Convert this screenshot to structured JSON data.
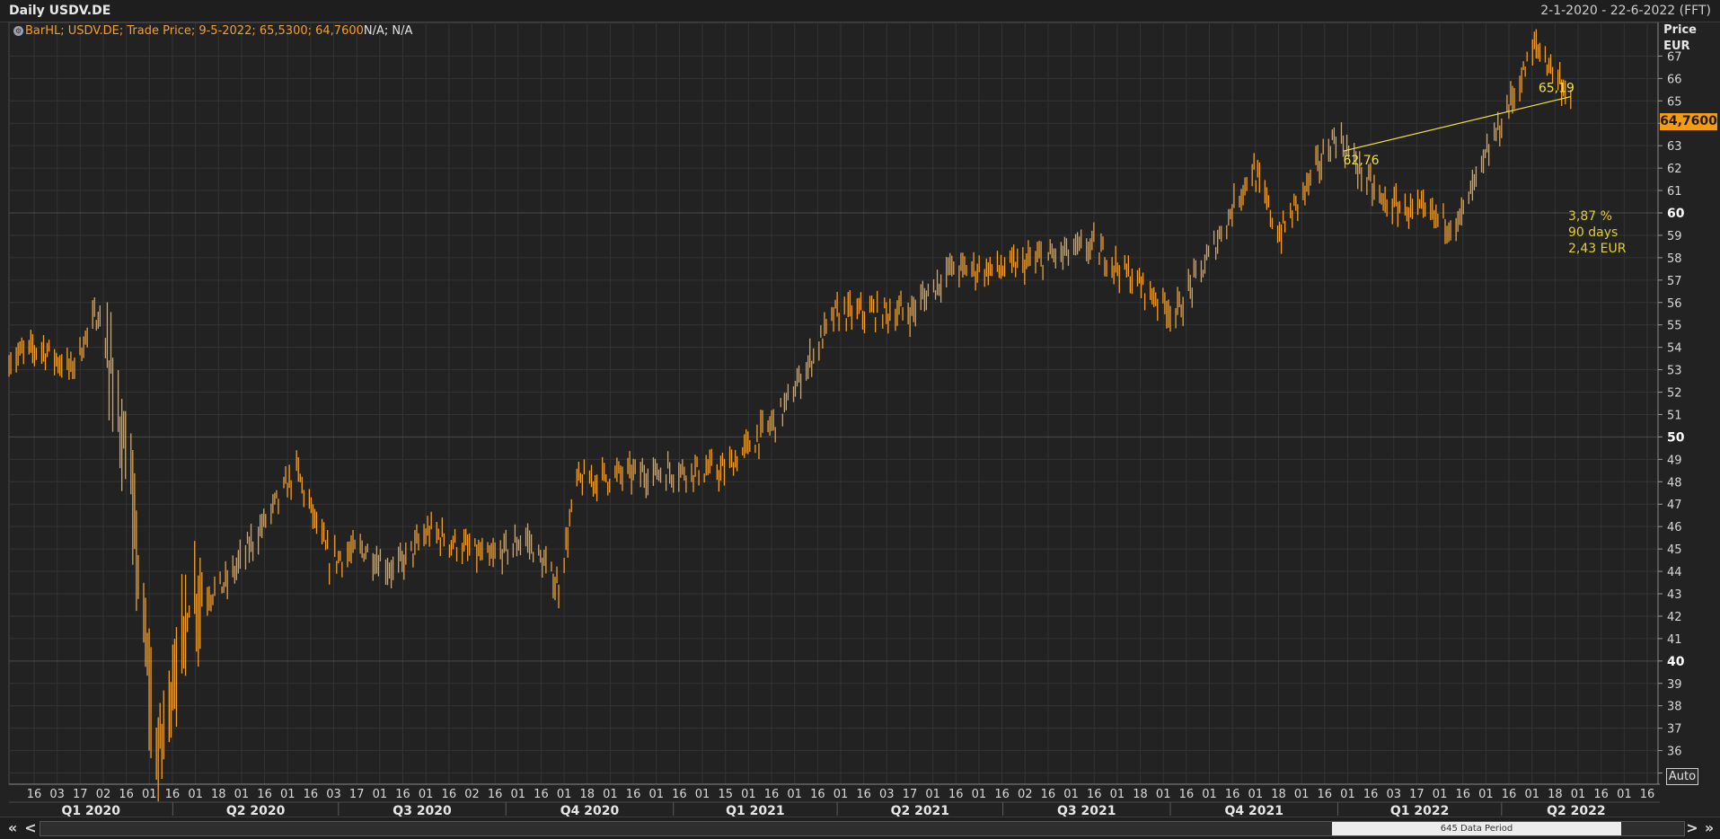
{
  "window": {
    "title": "Daily USDV.DE",
    "date_range": "2-1-2020 - 22-6-2022 (FFT)"
  },
  "legend": {
    "prefix": "BarHL; USDV.DE; Trade Price; 9-5-2022; 65,5300; 64,7600",
    "suffix": "N/A; N/A"
  },
  "price_axis": {
    "title": "Price",
    "currency": "EUR",
    "last_value": "64,7600"
  },
  "annotations": {
    "start_label": "62,76",
    "end_label": "65,19",
    "change_pct": "3,87 %",
    "period": "90 days",
    "change_abs": "2,43 EUR"
  },
  "controls": {
    "auto_label": "Auto",
    "scroll_caption": "645 Data Period",
    "first_label": "«",
    "prev_label": "<",
    "next_label": ">",
    "last_label": "»"
  },
  "colors": {
    "bars": "#f0a030",
    "trendline": "#f0e040",
    "background": "#222222",
    "grid": "#3a3a3a",
    "badge": "#f39c12"
  },
  "chart_data": {
    "type": "bar",
    "style": "high-low bars",
    "ylim": [
      34.5,
      68.5
    ],
    "yticks": [
      35,
      36,
      37,
      38,
      39,
      40,
      41,
      42,
      43,
      44,
      45,
      46,
      47,
      48,
      49,
      50,
      51,
      52,
      53,
      54,
      55,
      56,
      57,
      58,
      59,
      60,
      61,
      62,
      63,
      64,
      65,
      66,
      67
    ],
    "major_yticks": [
      40,
      50,
      60
    ],
    "grid": true,
    "x_ticks": [
      "16",
      "03",
      "17",
      "02",
      "16",
      "01",
      "16",
      "01",
      "18",
      "01",
      "16",
      "01",
      "16",
      "03",
      "17",
      "01",
      "16",
      "01",
      "16",
      "02",
      "16",
      "01",
      "16",
      "01",
      "18",
      "01",
      "16",
      "01",
      "16",
      "01",
      "15",
      "01",
      "16",
      "01",
      "16",
      "01",
      "16",
      "03",
      "17",
      "01",
      "16",
      "01",
      "16",
      "02",
      "16",
      "01",
      "16",
      "01",
      "18",
      "01",
      "16",
      "01",
      "16",
      "01",
      "18",
      "01",
      "16",
      "01",
      "16",
      "03",
      "17",
      "01",
      "16",
      "01",
      "16",
      "01",
      "18",
      "01",
      "16",
      "01",
      "16"
    ],
    "quarters": [
      "Q1 2020",
      "Q2 2020",
      "Q3 2020",
      "Q4 2020",
      "Q1 2021",
      "Q2 2021",
      "Q3 2021",
      "Q4 2021",
      "Q1 2022",
      "Q2 2022"
    ],
    "anchors": [
      {
        "date": "2020-01-02",
        "price": 53.5
      },
      {
        "date": "2020-01-20",
        "price": 54.0
      },
      {
        "date": "2020-02-05",
        "price": 53.0
      },
      {
        "date": "2020-02-20",
        "price": 55.6
      },
      {
        "date": "2020-02-28",
        "price": 52.5
      },
      {
        "date": "2020-03-09",
        "price": 47.5
      },
      {
        "date": "2020-03-23",
        "price": 35.5
      },
      {
        "date": "2020-04-10",
        "price": 42.5
      },
      {
        "date": "2020-05-01",
        "price": 43.5
      },
      {
        "date": "2020-06-08",
        "price": 48.5
      },
      {
        "date": "2020-06-26",
        "price": 44.5
      },
      {
        "date": "2020-07-15",
        "price": 45.0
      },
      {
        "date": "2020-08-01",
        "price": 44.0
      },
      {
        "date": "2020-08-20",
        "price": 45.8
      },
      {
        "date": "2020-09-22",
        "price": 44.5
      },
      {
        "date": "2020-10-12",
        "price": 45.5
      },
      {
        "date": "2020-10-30",
        "price": 43.3
      },
      {
        "date": "2020-11-09",
        "price": 48.0
      },
      {
        "date": "2020-12-01",
        "price": 48.3
      },
      {
        "date": "2021-01-04",
        "price": 48.5
      },
      {
        "date": "2021-01-29",
        "price": 48.5
      },
      {
        "date": "2021-03-01",
        "price": 51.0
      },
      {
        "date": "2021-03-31",
        "price": 55.5
      },
      {
        "date": "2021-05-12",
        "price": 55.6
      },
      {
        "date": "2021-06-02",
        "price": 57.5
      },
      {
        "date": "2021-07-01",
        "price": 57.5
      },
      {
        "date": "2021-08-20",
        "price": 58.5
      },
      {
        "date": "2021-10-04",
        "price": 55.5
      },
      {
        "date": "2021-10-22",
        "price": 58.0
      },
      {
        "date": "2021-11-15",
        "price": 62.0
      },
      {
        "date": "2021-11-30",
        "price": 59.0
      },
      {
        "date": "2021-12-31",
        "price": 63.5
      },
      {
        "date": "2022-01-25",
        "price": 60.5
      },
      {
        "date": "2022-03-08",
        "price": 59.5
      },
      {
        "date": "2022-03-29",
        "price": 63.5
      },
      {
        "date": "2022-04-20",
        "price": 67.5
      },
      {
        "date": "2022-05-09",
        "price": 65.2
      }
    ],
    "trendline": {
      "start_date": "2022-01-04",
      "start_price": 62.76,
      "end_date": "2022-05-09",
      "end_price": 65.19
    }
  }
}
